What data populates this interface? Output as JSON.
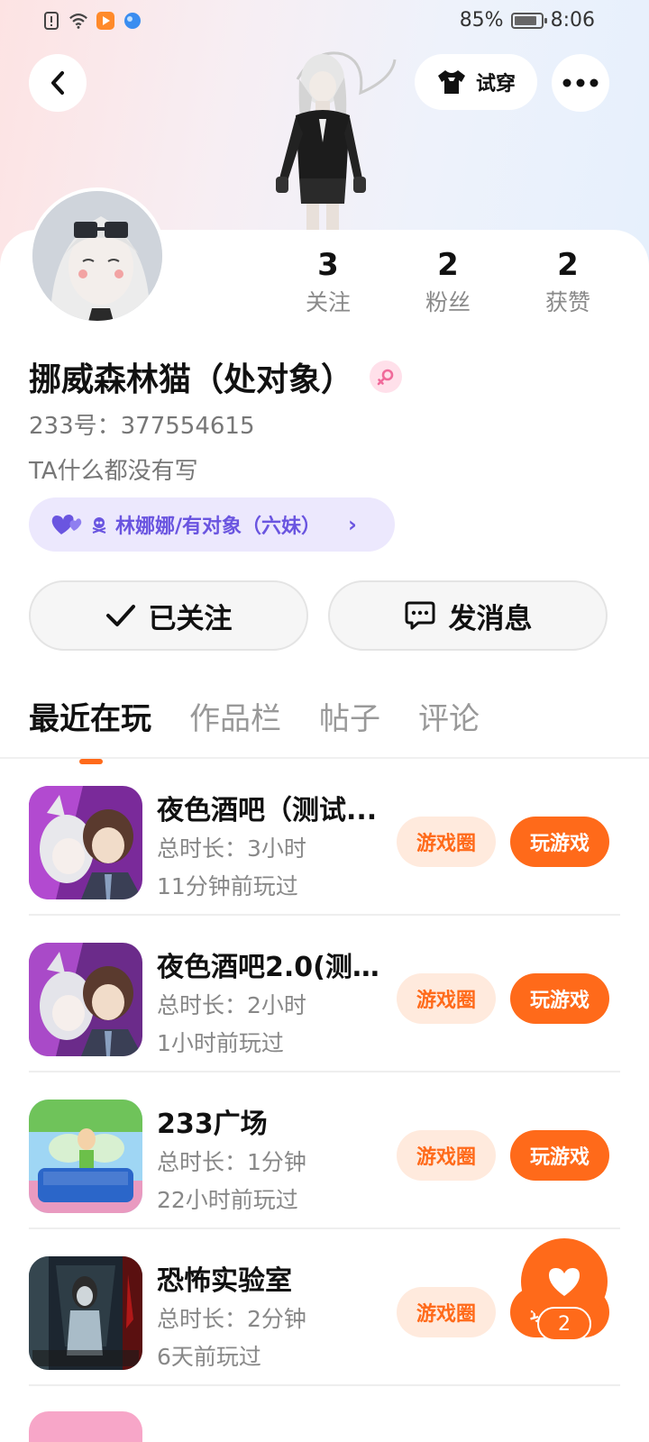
{
  "status_bar": {
    "battery_text": "85%",
    "battery_level": 0.85,
    "time": "8:06"
  },
  "header": {
    "try_on_label": "试穿"
  },
  "stats": [
    {
      "num": "3",
      "label": "关注"
    },
    {
      "num": "2",
      "label": "粉丝"
    },
    {
      "num": "2",
      "label": "获赞"
    }
  ],
  "profile": {
    "name": "挪威森林猫（处对象）",
    "uid": "233号：377554615",
    "bio": "TA什么都没有写",
    "relation": "林娜娜/有对象（六妹）"
  },
  "actions": {
    "follow_label": "已关注",
    "message_label": "发消息"
  },
  "tabs": [
    "最近在玩",
    "作品栏",
    "帖子",
    "评论"
  ],
  "games": [
    {
      "title": "夜色酒吧（测试...",
      "duration": "总时长：3小时",
      "last_played": "11分钟前玩过",
      "circle_label": "游戏圈",
      "play_label": "玩游戏"
    },
    {
      "title": "夜色酒吧2.0(测...",
      "duration": "总时长：2小时",
      "last_played": "1小时前玩过",
      "circle_label": "游戏圈",
      "play_label": "玩游戏"
    },
    {
      "title": "233广场",
      "duration": "总时长：1分钟",
      "last_played": "22小时前玩过",
      "circle_label": "游戏圈",
      "play_label": "玩游戏"
    },
    {
      "title": "恐怖实验室",
      "duration": "总时长：2分钟",
      "last_played": "6天前玩过",
      "circle_label": "游戏圈",
      "play_label": "玩游戏"
    }
  ],
  "fab": {
    "count": "2"
  },
  "colors": {
    "accent": "#ff6a1a",
    "accent_light": "#ffeadd",
    "relation_bg": "#ece8fd",
    "relation_text": "#6a55e0"
  }
}
